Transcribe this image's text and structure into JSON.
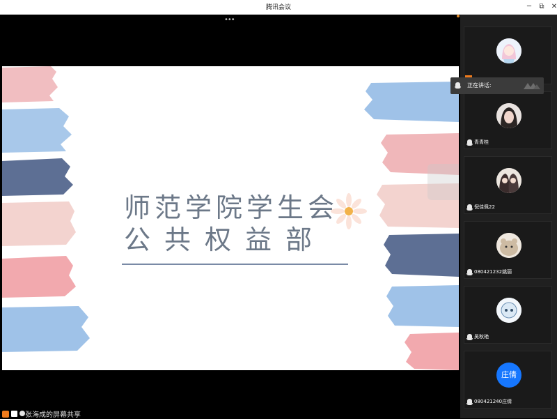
{
  "window": {
    "title": "腾讯会议"
  },
  "title_bar": {
    "min": "─",
    "max": "⧉",
    "close": "✕"
  },
  "toolbar": {
    "more": "•••"
  },
  "slide": {
    "line1": "师范学院学生会",
    "line2": "公共权益部"
  },
  "speaking": {
    "label": "正在讲话:"
  },
  "participants": [
    {
      "name": ""
    },
    {
      "name": "青青桂"
    },
    {
      "name": "倪佳佩22"
    },
    {
      "name": "080421232姚丽"
    },
    {
      "name": "吴秋艳"
    },
    {
      "name": "080421240庄倩",
      "avatar_text": "庄倩"
    }
  ],
  "share": {
    "text": "张海成的屏幕共享"
  },
  "colors": {
    "accent": "#1677ff",
    "orange": "#f07b1c"
  }
}
